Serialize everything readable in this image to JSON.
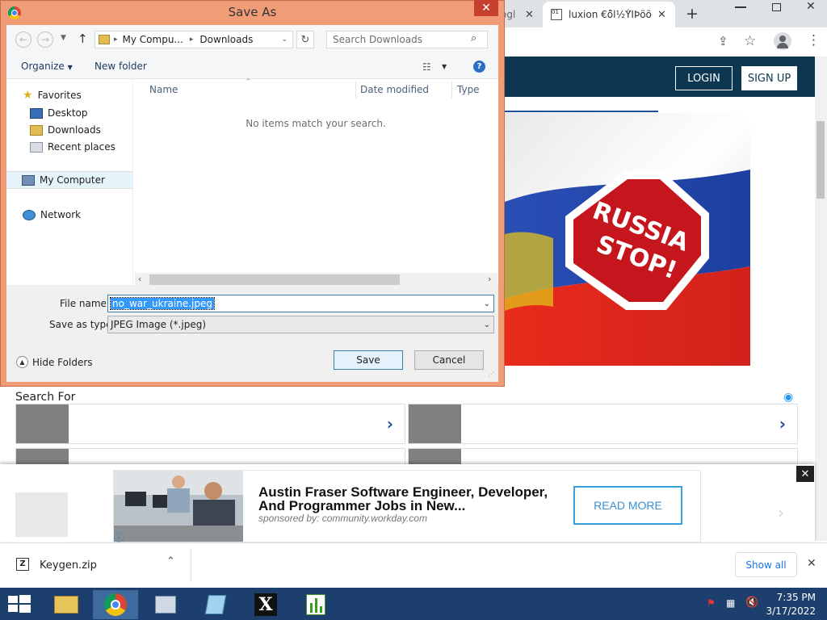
{
  "browser": {
    "tabs": [
      {
        "label": "ogl"
      },
      {
        "label": "luxion €ô̈l½Ý̈IÞöö-("
      }
    ],
    "new_tab": "+",
    "tab_close": "✕"
  },
  "site": {
    "login_label": "LOGIN",
    "signup_label": "SIGN UP",
    "hero_sign_line1": "RUSSIA",
    "hero_sign_line2": "STOP!",
    "search_for": "Search For",
    "chevron": "›"
  },
  "ad": {
    "title": "Austin Fraser Software Engineer, Developer, And Programmer Jobs in New...",
    "sponsor": "sponsored by: community.workday.com",
    "cta": "READ MORE",
    "close": "✕"
  },
  "downloads": {
    "file_name": "Keygen.zip",
    "show_all": "Show all",
    "close": "✕"
  },
  "taskbar": {
    "time": "7:35 PM",
    "date": "3/17/2022"
  },
  "dialog": {
    "title": "Save As",
    "breadcrumb": [
      "My Compu...",
      "Downloads"
    ],
    "search_placeholder": "Search Downloads",
    "organize_label": "Organize",
    "new_folder_label": "New folder",
    "nav": {
      "favorites": "Favorites",
      "desktop": "Desktop",
      "downloads": "Downloads",
      "recent": "Recent places",
      "computer": "My Computer",
      "network": "Network"
    },
    "columns": [
      "Name",
      "Date modified",
      "Type"
    ],
    "empty_message": "No items match your search.",
    "file_name_label": "File name:",
    "file_name_value": "no_war_ukraine.jpeg",
    "save_type_label": "Save as type:",
    "save_type_value": "JPEG Image (*.jpeg)",
    "hide_folders_label": "Hide Folders",
    "save_label": "Save",
    "cancel_label": "Cancel"
  },
  "colors": {
    "dialog_frame": "#ef9c77",
    "site_header": "#0d3750",
    "taskbar": "#1c3f6e",
    "link_blue": "#1f4e9c"
  }
}
